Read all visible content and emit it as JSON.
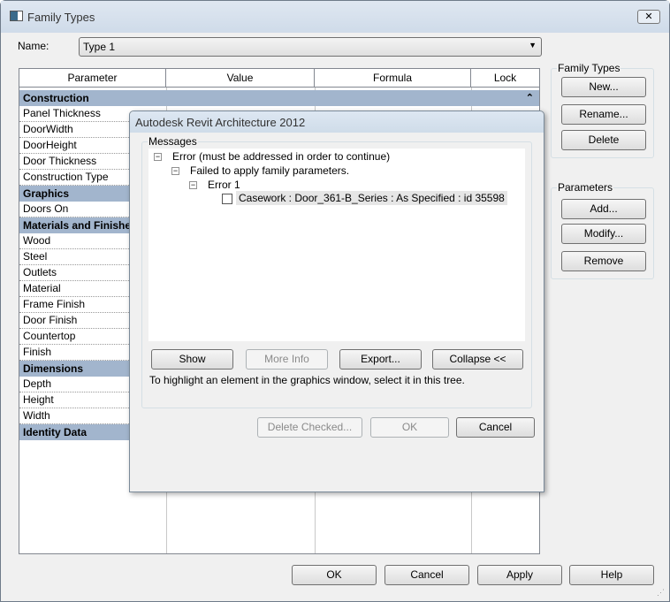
{
  "window": {
    "title": "Family Types",
    "close": "✕"
  },
  "name_field": {
    "label": "Name:",
    "value": "Type 1"
  },
  "table": {
    "headers": [
      "Parameter",
      "Value",
      "Formula",
      "Lock"
    ],
    "groups": [
      {
        "name": "Construction",
        "items": [
          "Panel Thickness",
          "DoorWidth",
          "DoorHeight",
          "Door Thickness",
          "Construction Type"
        ]
      },
      {
        "name": "Graphics",
        "items": [
          "Doors On"
        ]
      },
      {
        "name": "Materials and Finishes",
        "items": [
          "Wood",
          "Steel",
          "Outlets",
          "Material",
          "Frame Finish",
          "Door Finish",
          "Countertop",
          "Finish"
        ]
      },
      {
        "name": "Dimensions",
        "items": [
          "Depth",
          "Height",
          "Width"
        ]
      },
      {
        "name": "Identity Data",
        "items": []
      }
    ]
  },
  "family_types": {
    "label": "Family Types",
    "new": "New...",
    "rename": "Rename...",
    "delete": "Delete"
  },
  "parameters": {
    "label": "Parameters",
    "add": "Add...",
    "modify": "Modify...",
    "remove": "Remove"
  },
  "footer": {
    "ok": "OK",
    "cancel": "Cancel",
    "apply": "Apply",
    "help": "Help"
  },
  "dialog": {
    "title": "Autodesk Revit Architecture 2012",
    "messages_label": "Messages",
    "tree": [
      "Error (must be addressed in order to continue)",
      "Failed to apply family parameters.",
      "Error 1",
      "Casework : Door_361-B_Series : As Specified : id 35598"
    ],
    "show": "Show",
    "more_info": "More Info",
    "export": "Export...",
    "collapse": "Collapse <<",
    "hint": "To highlight an element in the graphics window, select it in this tree.",
    "delete_checked": "Delete Checked...",
    "ok": "OK",
    "cancel": "Cancel"
  }
}
